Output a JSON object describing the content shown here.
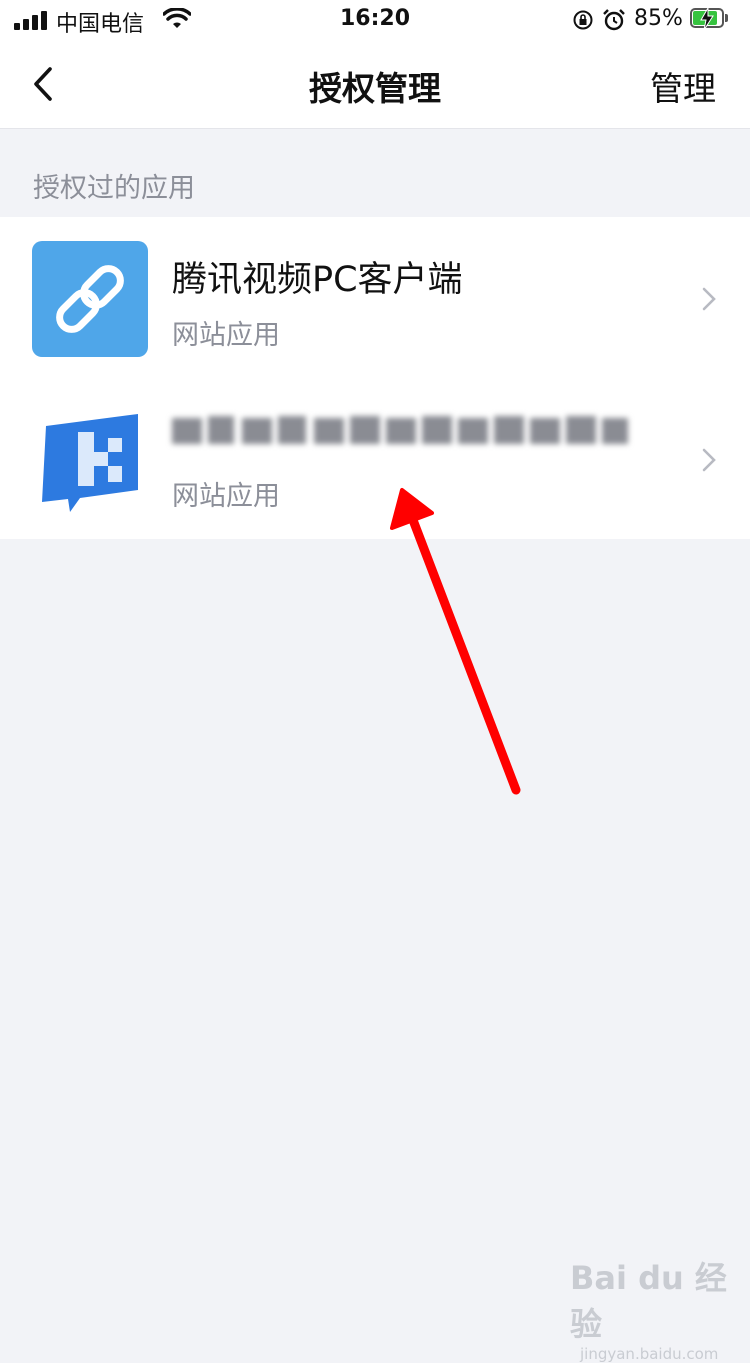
{
  "status_bar": {
    "carrier": "中国电信",
    "time": "16:20",
    "battery": "85%",
    "battery_level": 0.85
  },
  "nav": {
    "title": "授权管理",
    "manage_label": "管理"
  },
  "section_label": "授权过的应用",
  "apps": [
    {
      "name": "腾讯视频PC客户端",
      "type": "网站应用"
    },
    {
      "name": "",
      "type": "网站应用"
    }
  ],
  "colors": {
    "link_icon_bg": "#4fa6e9",
    "annotation_arrow": "#ff0000"
  },
  "watermark": {
    "main": "Bai du 经验",
    "sub": "jingyan.baidu.com"
  }
}
